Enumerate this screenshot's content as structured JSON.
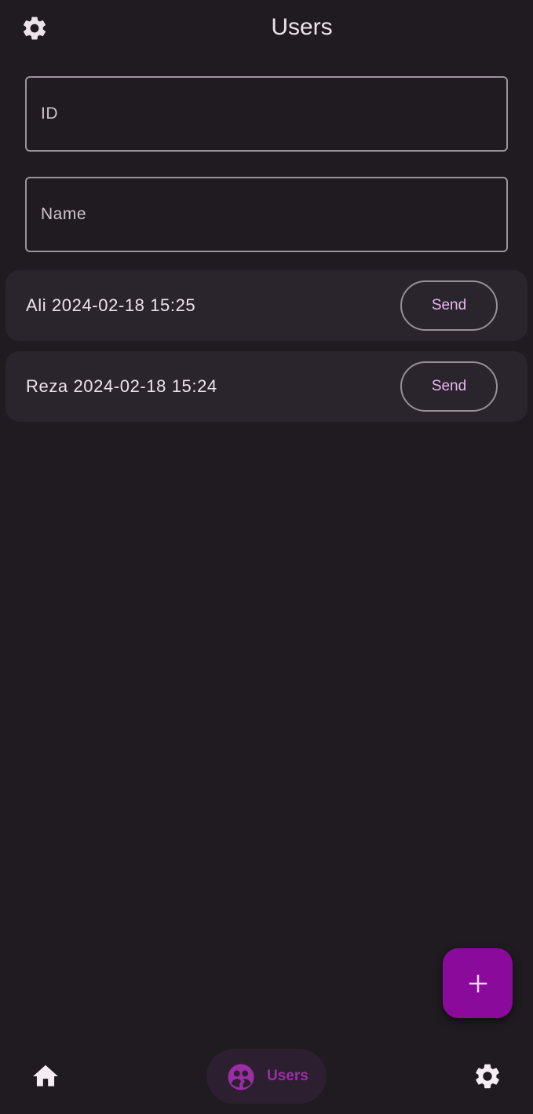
{
  "topbar": {
    "title": "Users",
    "settings_icon": "gear-icon"
  },
  "form": {
    "id_field": {
      "placeholder": "ID",
      "value": ""
    },
    "name_field": {
      "placeholder": "Name",
      "value": ""
    }
  },
  "users": [
    {
      "text": "Ali 2024-02-18 15:25",
      "button_label": "Send"
    },
    {
      "text": "Reza 2024-02-18 15:24",
      "button_label": "Send"
    }
  ],
  "fab": {
    "icon": "plus-icon"
  },
  "bottom_nav": {
    "home": {
      "icon": "home-icon"
    },
    "users": {
      "icon": "users-icon",
      "label": "Users"
    },
    "settings": {
      "icon": "gear-icon"
    }
  },
  "colors": {
    "background": "#1f1b20",
    "card": "#2a252c",
    "accent": "#8a0a9c",
    "send_text": "#eab6f0",
    "nav_active_text": "#9b2ea6"
  }
}
